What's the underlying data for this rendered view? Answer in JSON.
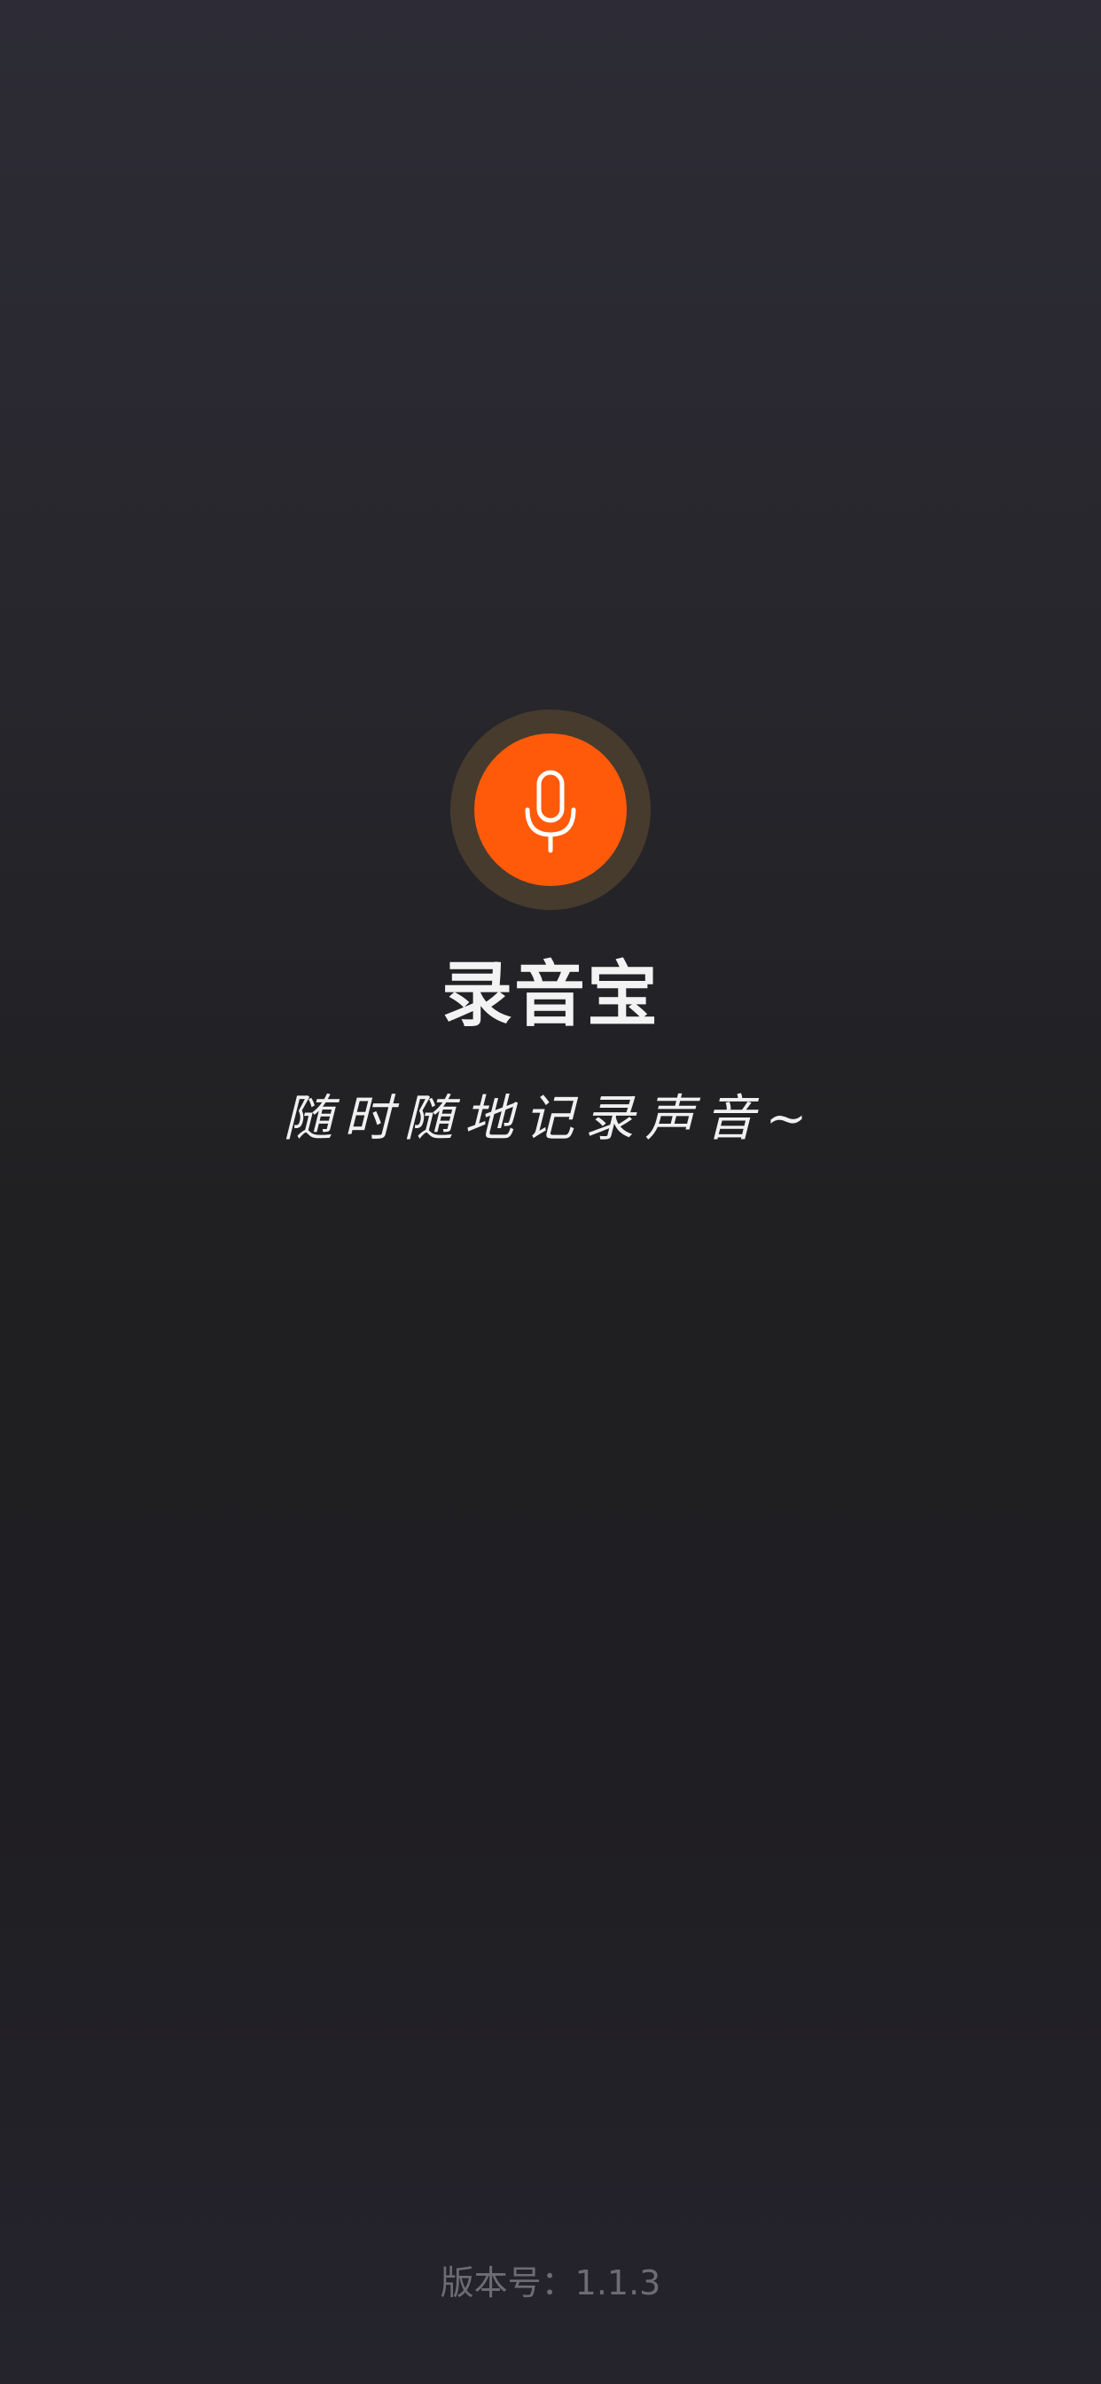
{
  "app": {
    "name": "录音宝",
    "slogan": "随时随地记录声音~",
    "version_text": "版本号：1.1.3"
  },
  "logo": {
    "icon": "microphone-icon",
    "accent_color": "#ff5a0a",
    "ring_color": "#473b2e"
  },
  "colors": {
    "background_top": "#2d2c36",
    "background_mid": "#1f1f21",
    "text_primary": "#f3f3f3",
    "text_muted": "#6d6c74"
  }
}
